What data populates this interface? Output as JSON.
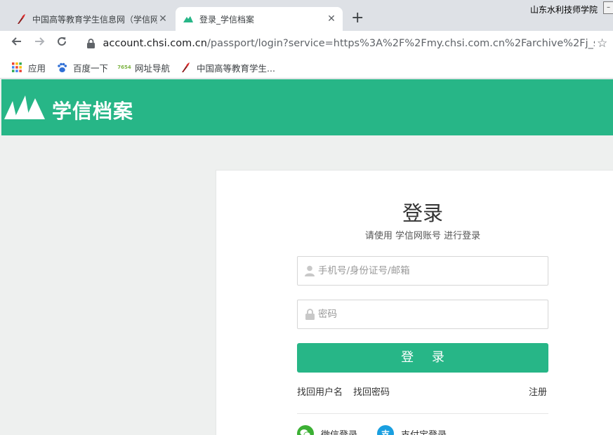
{
  "browser": {
    "window_title": "山东水利技师学院",
    "tabs": [
      {
        "title": "中国高等教育学生信息网（学信网",
        "close": "✕"
      },
      {
        "title": "登录_学信档案",
        "close": "✕"
      }
    ],
    "new_tab": "+",
    "url_host": "account.chsi.com.cn",
    "url_path": "/passport/login?service=https%3A%2F%2Fmy.chsi.com.cn%2Farchive%2Fj_spring...",
    "bookmarks": [
      {
        "label": "应用",
        "icon": "apps-grid-icon"
      },
      {
        "label": "百度一下",
        "icon": "baidu-paw-icon"
      },
      {
        "label": "网址导航",
        "icon": "7654-icon",
        "icon_text": "7654"
      },
      {
        "label": "中国高等教育学生...",
        "icon": "chsi-torch-icon"
      }
    ]
  },
  "header": {
    "site_name": "学信档案"
  },
  "login": {
    "title": "登录",
    "subtitle": "请使用 学信网账号 进行登录",
    "username_placeholder": "手机号/身份证号/邮箱",
    "password_placeholder": "密码",
    "submit_label": "登 录",
    "find_username": "找回用户名",
    "find_password": "找回密码",
    "register": "注册",
    "wechat_label": "微信登录",
    "alipay_label": "支付宝登录",
    "alipay_glyph": "支"
  },
  "colors": {
    "brand": "#27b687",
    "wechat": "#3cb034",
    "alipay": "#1a9fe0"
  }
}
